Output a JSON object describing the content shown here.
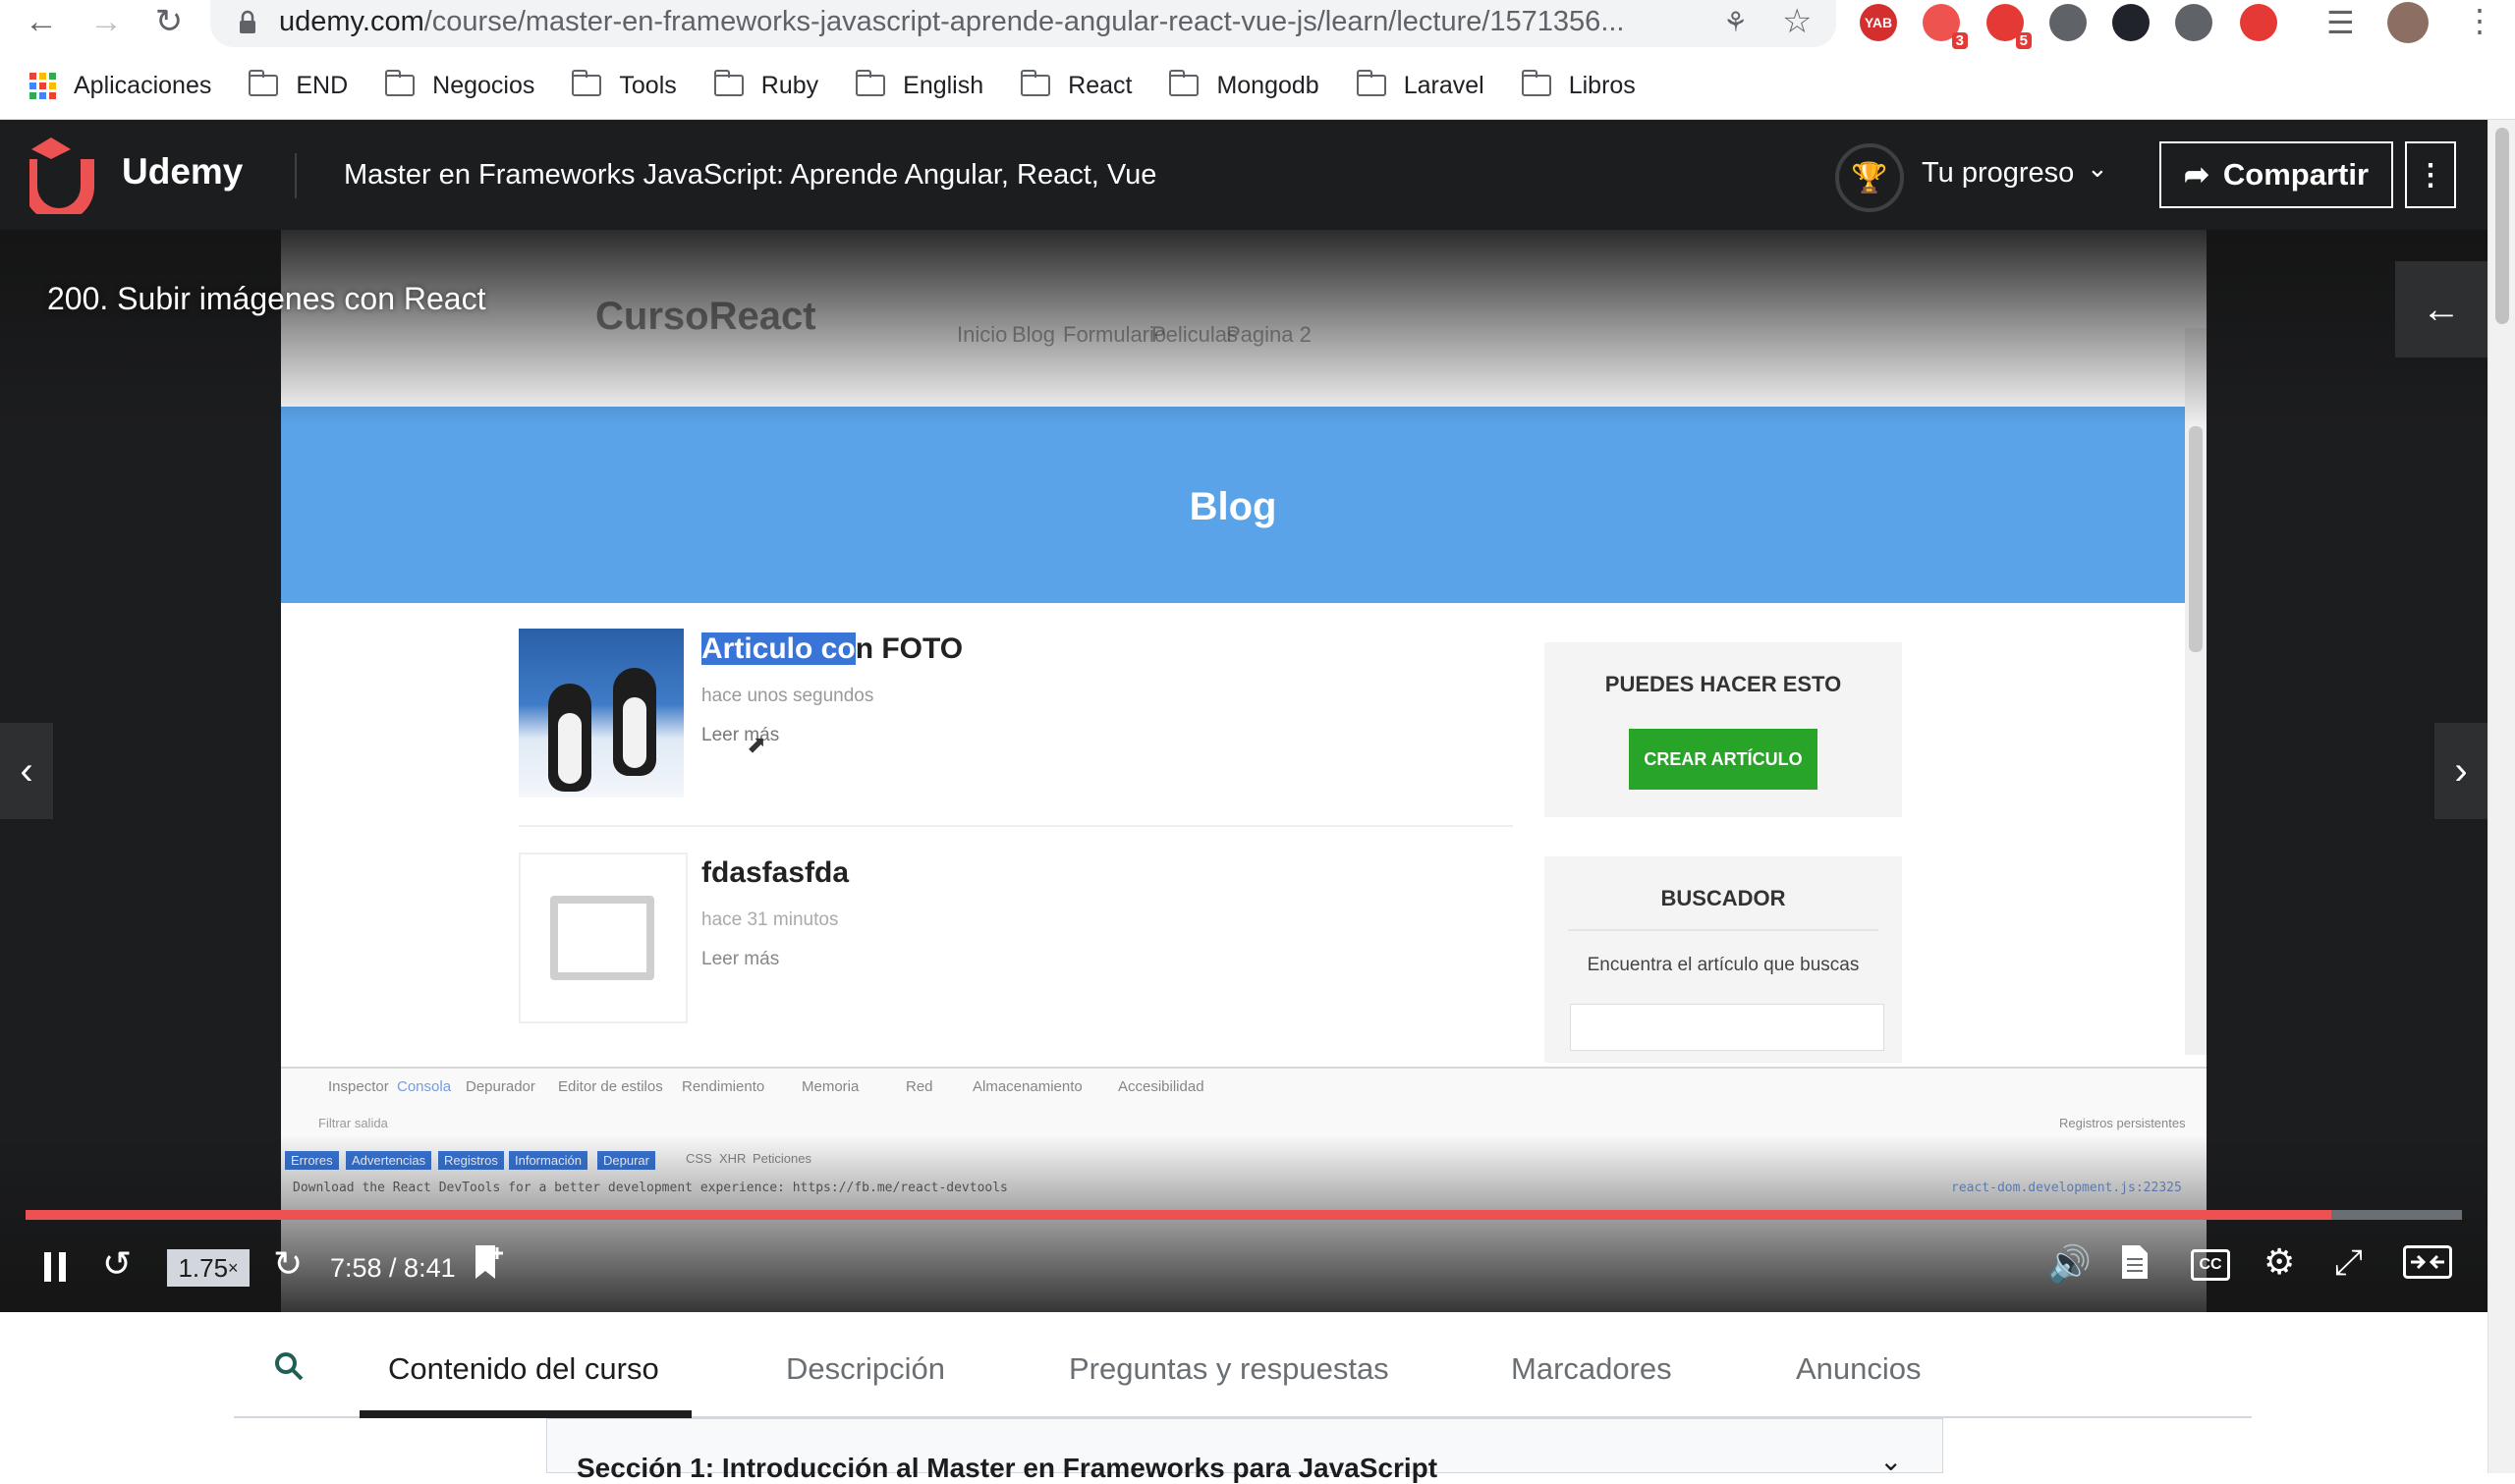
{
  "browser": {
    "url_domain": "udemy.com",
    "url_path": "/course/master-en-frameworks-javascript-aprende-angular-react-vue-js/learn/lecture/1571356...",
    "extensions": [
      {
        "name": "yab-extension-icon",
        "label": "YAB",
        "color": "#d32f2f"
      },
      {
        "name": "extension-badge-3-icon",
        "badge": "3",
        "color": "#ef5350"
      },
      {
        "name": "extension-badge-5-icon",
        "badge": "5",
        "color": "#e53935"
      },
      {
        "name": "code-extension-icon",
        "color": "#5f6368"
      },
      {
        "name": "react-devtools-icon",
        "color": "#20232a"
      },
      {
        "name": "vue-devtools-icon",
        "color": "#5f6368"
      },
      {
        "name": "shield-extension-icon",
        "color": "#e53935"
      }
    ],
    "bookmarks": [
      "Aplicaciones",
      "END",
      "Negocios",
      "Tools",
      "Ruby",
      "English",
      "React",
      "Mongodb",
      "Laravel",
      "Libros"
    ]
  },
  "header": {
    "logo_text": "Udemy",
    "course_title": "Master en Frameworks JavaScript: Aprende Angular, React, Vue",
    "progress_label": "Tu progreso",
    "share_label": "Compartir"
  },
  "video": {
    "lecture_title": "200. Subir imágenes con React",
    "progress_fraction": 0.9465,
    "playback_rate": "1.75",
    "playback_rate_suffix": "×",
    "time_display": "7:58 / 8:41",
    "accent_color": "#ec5252",
    "cc_label": "CC",
    "content": {
      "brand": "CursoReact",
      "nav": [
        "Inicio",
        "Blog",
        "Formulario",
        "Peliculas",
        "Pagina 2"
      ],
      "hero_title": "Blog",
      "article1": {
        "title_selected": "Articulo co",
        "title_rest": "n FOTO",
        "meta": "hace unos segundos",
        "more": "Leer más"
      },
      "article2": {
        "title": "fdasfasfda",
        "meta": "hace 31 minutos",
        "more": "Leer más"
      },
      "widget1": {
        "title": "PUEDES HACER ESTO",
        "button": "CREAR ARTÍCULO"
      },
      "widget2": {
        "title": "BUSCADOR",
        "desc": "Encuentra el artículo que buscas"
      },
      "devtools": {
        "tabs": [
          "Inspector",
          "Consola",
          "Depurador",
          "Editor de estilos",
          "Rendimiento",
          "Memoria",
          "Red",
          "Almacenamiento",
          "Accesibilidad"
        ],
        "filter_placeholder": "Filtrar salida",
        "persist_label": "Registros persistentes",
        "filters": [
          "Errores",
          "Advertencias",
          "Registros",
          "Información",
          "Depurar"
        ],
        "filters_plain": [
          "CSS",
          "XHR",
          "Peticiones"
        ],
        "log": "Download the React DevTools for a better development experience: https://fb.me/react-devtools",
        "log_source": "react-dom.development.js:22325"
      }
    }
  },
  "tabs": [
    "Contenido del curso",
    "Descripción",
    "Preguntas y respuestas",
    "Marcadores",
    "Anuncios"
  ],
  "section": {
    "title": "Sección 1: Introducción al Master en Frameworks para JavaScript"
  }
}
